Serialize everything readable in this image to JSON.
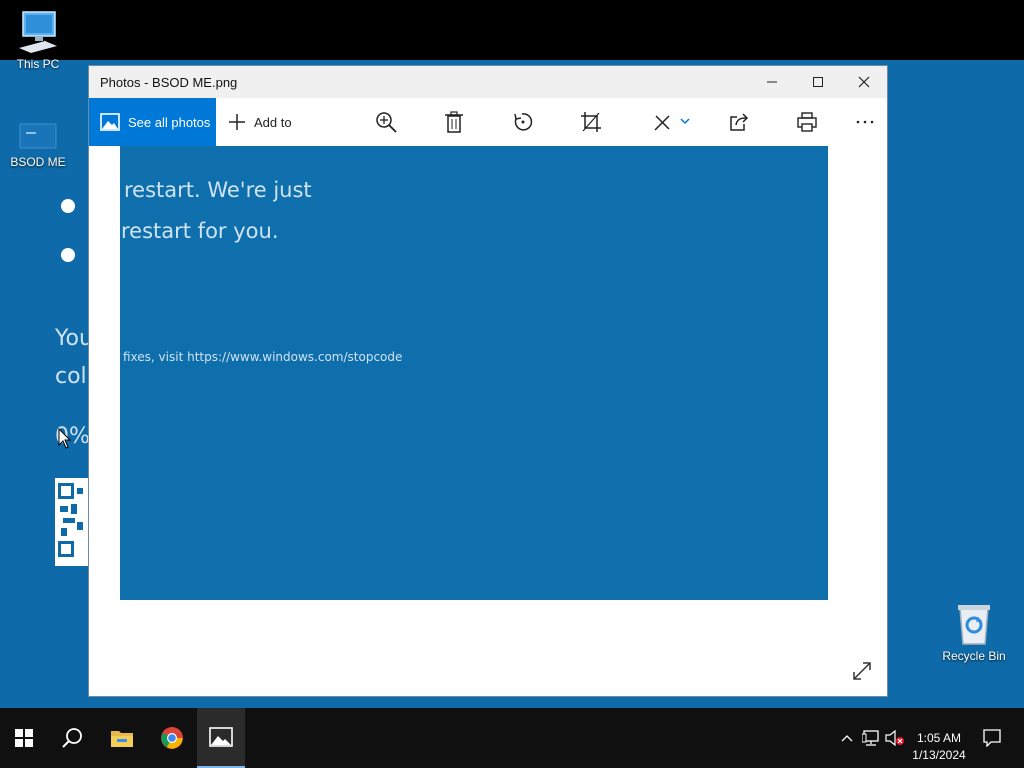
{
  "desktop": {
    "icons": [
      {
        "label": "This PC"
      },
      {
        "label": "BSOD ME"
      },
      {
        "label": "Recycle Bin"
      }
    ],
    "wallpaper_fragments": [
      "You",
      "coll",
      "0%"
    ]
  },
  "window": {
    "title": "Photos - BSOD ME.png",
    "toolbar": {
      "see_all": "See all photos",
      "add_to": "Add to",
      "icons": [
        "zoom-in",
        "delete",
        "rotate",
        "crop",
        "edit",
        "share",
        "print",
        "more"
      ]
    },
    "image_text": {
      "line1": "restart. We're just",
      "line2": "restart for you.",
      "line3": "fixes, visit https://www.windows.com/stopcode"
    }
  },
  "taskbar": {
    "clock_time": "1:05 AM",
    "clock_date": "1/13/2024"
  },
  "colors": {
    "accent": "#0078d7",
    "bsod_blue": "#0f6fad",
    "taskbar": "#101010"
  }
}
